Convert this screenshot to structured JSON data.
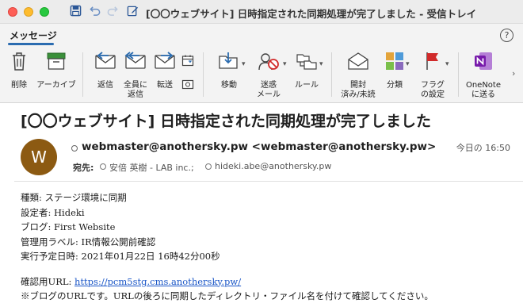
{
  "window": {
    "title": "[〇〇ウェブサイト] 日時指定された同期処理が完了しました - 受信トレイ"
  },
  "tabs": {
    "active": "メッセージ"
  },
  "ribbon": {
    "delete": "削除",
    "archive": "アーカイブ",
    "reply": "返信",
    "reply_all_1": "全員に",
    "reply_all_2": "返信",
    "forward": "転送",
    "move": "移動",
    "junk_1": "迷惑",
    "junk_2": "メール",
    "rules": "ルール",
    "read_1": "開封",
    "read_2": "済み/未読",
    "categorize": "分類",
    "flag_1": "フラグ",
    "flag_2": "の設定",
    "onenote_1": "OneNote",
    "onenote_2": "に送る"
  },
  "message": {
    "subject": "[〇〇ウェブサイト] 日時指定された同期処理が完了しました",
    "avatar_initial": "W",
    "from": "webmaster@anothersky.pw <webmaster@anothersky.pw>",
    "date": "今日の 16:50",
    "to_label": "宛先:",
    "to_1": "安倍 英樹 - LAB inc.;",
    "to_2": "hideki.abe@anothersky.pw"
  },
  "body": {
    "line1": "種類: ステージ環境に同期",
    "line2": "設定者: Hideki",
    "line3": "ブログ: First Website",
    "line4": "管理用ラベル: IR情報公開前確認",
    "line5": "実行予定日時: 2021年01月22日 16時42分00秒",
    "url_label": "確認用URL: ",
    "url": "https://pcm5stg.cms.anothersky.pw/",
    "note": "※ブログのURLです。URLの後ろに同期したディレクトリ・ファイル名を付けて確認してください。"
  }
}
